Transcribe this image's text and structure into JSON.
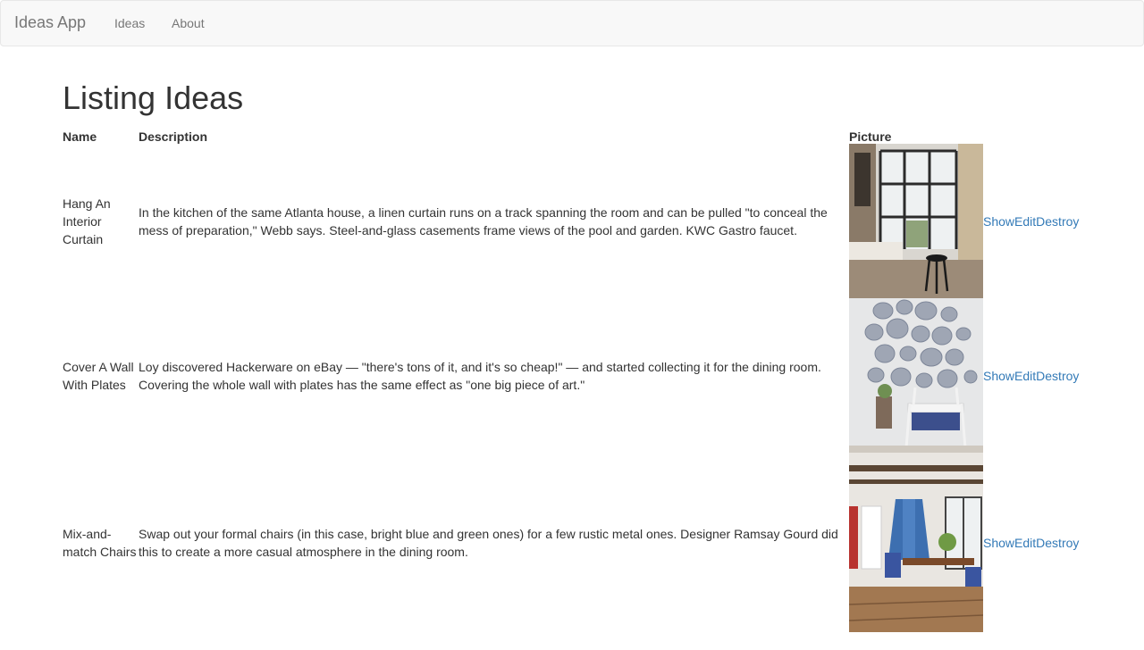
{
  "navbar": {
    "brand": "Ideas App",
    "links": [
      "Ideas",
      "About"
    ]
  },
  "page_title": "Listing Ideas",
  "table": {
    "headers": {
      "name": "Name",
      "description": "Description",
      "picture": "Picture"
    },
    "actions": [
      "Show",
      "Edit",
      "Destroy"
    ],
    "rows": [
      {
        "name": "Hang An Interior Curtain",
        "description": "In the kitchen of the same Atlanta house, a linen curtain runs on a track spanning the room and can be pulled \"to conceal the mess of preparation,\" Webb says. Steel-and-glass casements frame views of the pool and garden. KWC Gastro faucet."
      },
      {
        "name": "Cover A Wall With Plates",
        "description": "Loy discovered Hackerware on eBay — \"there's tons of it, and it's so cheap!\" — and started collecting it for the dining room. Covering the whole wall with plates has the same effect as \"one big piece of art.\""
      },
      {
        "name": "Mix-and-match Chairs",
        "description": "Swap out your formal chairs (in this case, bright blue and green ones) for a few rustic metal ones. Designer Ramsay Gourd did this to create a more casual atmosphere in the dining room."
      }
    ]
  },
  "colors": {
    "link": "#337ab7",
    "nav_text": "#777777",
    "navbar_bg": "#f8f8f8"
  }
}
